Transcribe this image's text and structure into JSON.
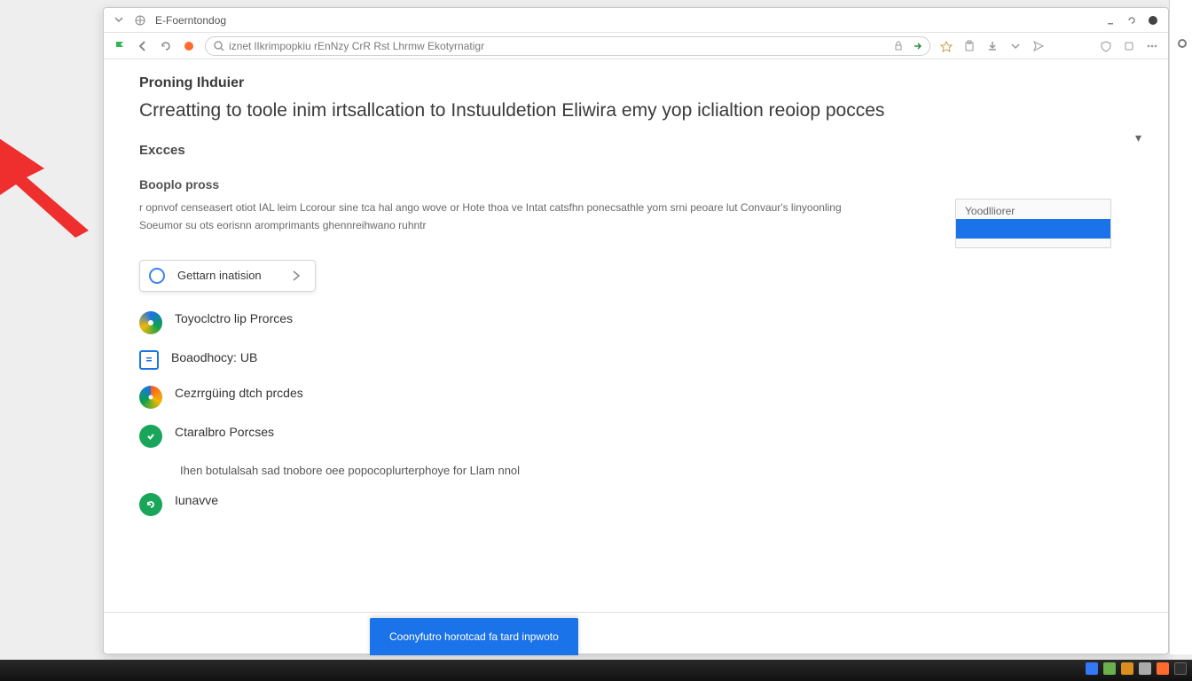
{
  "titlebar": {
    "tab_label": "E-Foerntondog"
  },
  "toolbar": {
    "url": "iznet lIkrimpopkiu rEnNzy  CrR Rst Lhrmw Ekotyrnatigr"
  },
  "header": {
    "crumbs": "Proning Ihduier",
    "headline": "Crreatting to toole inim irtsallcation to Instuuldetion Eliwira emy yop iclialtion reoiop pocces",
    "section": "Excces",
    "subhead": "Booplo pross",
    "paragraph": "r opnvof censeasert otiot IAL leim Lcorour sine tca hal ango wove or Hote thoa ve Intat catsfhn ponecsathle yom srni peoare lut Convaur's linyoonling Soeumor su ots eorisnn aromprimants ghennreihwano ruhntr"
  },
  "sidecard": {
    "label": "Yoodlliorer"
  },
  "pill": {
    "label": "Gettarn inatision"
  },
  "steps": [
    {
      "icon": "target",
      "label": "Toyoclctro lip Prorces"
    },
    {
      "icon": "doc",
      "label": "Boaodhocy:  UB"
    },
    {
      "icon": "swirl",
      "label": "Cezrrgüing dtch prcdes"
    },
    {
      "icon": "check",
      "label": "Ctaralbro Porcses"
    },
    {
      "icon": "refresh",
      "label": "Iunavve"
    }
  ],
  "step_note": "Ihen botulalsah sad tnobore oee popocoplurterphoye for Llam nnol",
  "bottom_button": "Coonyfutro horotcad fa tard inpwoto",
  "collapse_caret": "▾"
}
